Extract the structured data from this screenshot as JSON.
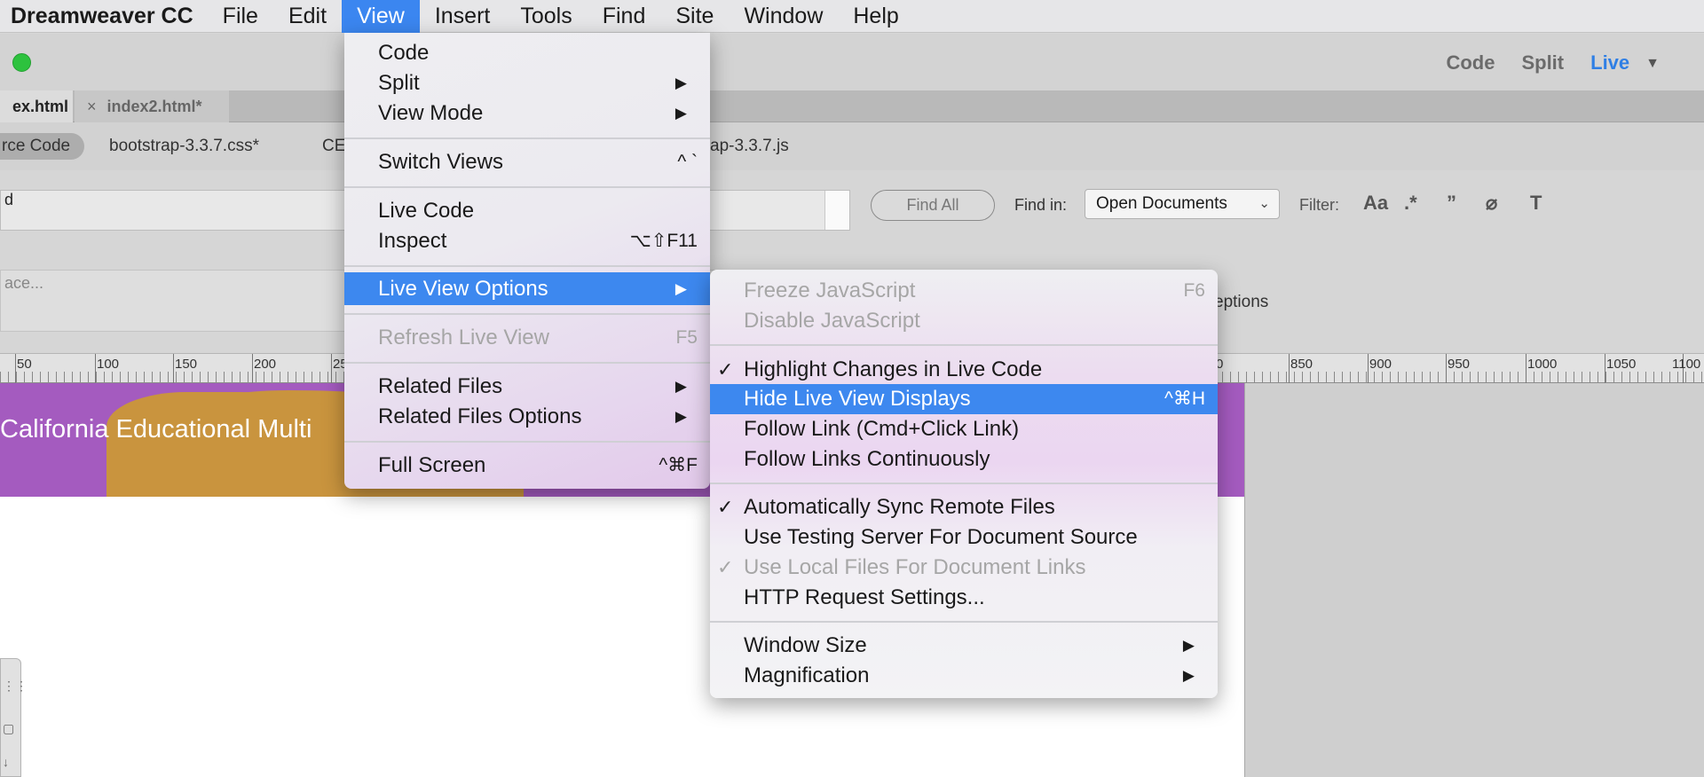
{
  "menubar": {
    "app_name": "Dreamweaver CC",
    "items": [
      "File",
      "Edit",
      "View",
      "Insert",
      "Tools",
      "Find",
      "Site",
      "Window",
      "Help"
    ],
    "active": "View"
  },
  "toolbar": {
    "view_buttons": {
      "code": "Code",
      "split": "Split",
      "live": "Live"
    }
  },
  "tabs": [
    {
      "label": "ex.html",
      "close": ""
    },
    {
      "label": "index2.html*",
      "close": "×"
    }
  ],
  "related_files": [
    "rce Code",
    "bootstrap-3.3.7.css*",
    "CE",
    "ap-3.3.7.js"
  ],
  "find_panel": {
    "find_text": "d",
    "replace_placeholder": "ace...",
    "find_all": "Find All",
    "find_in_label": "Find in:",
    "find_in_value": "Open Documents",
    "filter_label": "Filter:",
    "filter_icons": [
      "Aa",
      ".*",
      "”",
      "⌀",
      "T"
    ],
    "options_text": "eptions"
  },
  "ruler": {
    "labels": [
      "50",
      "100",
      "150",
      "200",
      "25",
      "0",
      "850",
      "900",
      "950",
      "1000",
      "1050",
      "1100"
    ]
  },
  "live": {
    "hero_title": "California Educational Multi"
  },
  "view_menu": {
    "items": [
      {
        "label": "Code"
      },
      {
        "label": "Split",
        "arrow": "▶"
      },
      {
        "label": "View Mode",
        "arrow": "▶"
      },
      {
        "label": "Switch Views",
        "shortcut": "^ `"
      },
      {
        "label": "Live Code"
      },
      {
        "label": "Inspect",
        "shortcut": "⌥⇧F11"
      },
      {
        "label": "Live View Options",
        "arrow": "▶",
        "selected": true
      },
      {
        "label": "Refresh Live View",
        "shortcut": "F5",
        "disabled": true
      },
      {
        "label": "Related Files",
        "arrow": "▶"
      },
      {
        "label": "Related Files Options",
        "arrow": "▶"
      },
      {
        "label": "Full Screen",
        "shortcut": "^⌘F"
      }
    ]
  },
  "live_view_options_menu": {
    "items": [
      {
        "label": "Freeze JavaScript",
        "shortcut": "F6",
        "disabled": true
      },
      {
        "label": "Disable JavaScript",
        "disabled": true
      },
      {
        "label": "Highlight Changes in Live Code",
        "check": "✓"
      },
      {
        "label": "Hide Live View Displays",
        "shortcut": "^⌘H",
        "selected": true
      },
      {
        "label": "Follow Link (Cmd+Click Link)"
      },
      {
        "label": "Follow Links Continuously"
      },
      {
        "label": "Automatically Sync Remote Files",
        "check": "✓"
      },
      {
        "label": "Use Testing Server For Document Source"
      },
      {
        "label": "Use Local Files For Document Links",
        "check": "✓",
        "disabled": true
      },
      {
        "label": "HTTP Request Settings..."
      },
      {
        "label": "Window Size",
        "arrow": "▶"
      },
      {
        "label": "Magnification",
        "arrow": "▶"
      }
    ]
  }
}
